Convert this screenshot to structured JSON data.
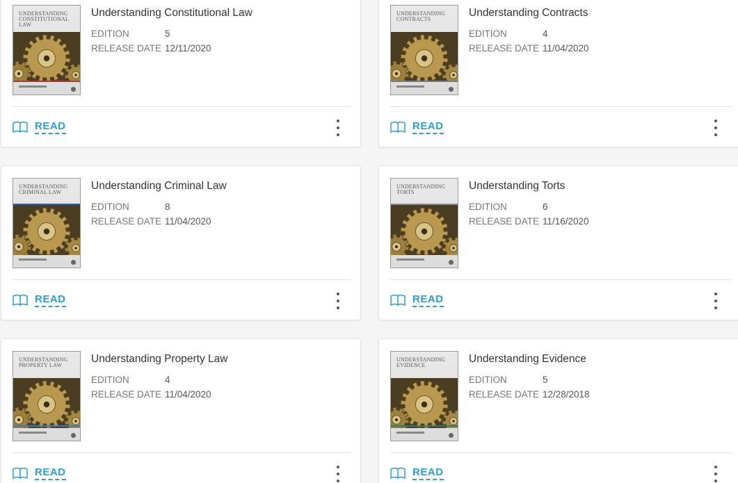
{
  "labels": {
    "edition": "EDITION",
    "release_date": "RELEASE DATE",
    "read": "READ"
  },
  "colors": {
    "accent": "#2a9fd6"
  },
  "books": [
    {
      "title": "Understanding Constitutional Law",
      "cover_text": "Understanding Constitutional Law",
      "band_color": "#b03a2e",
      "edition": "5",
      "release_date": "12/11/2020"
    },
    {
      "title": "Understanding Contracts",
      "cover_text": "Understanding Contracts",
      "band_color": "#7a7a7a",
      "edition": "4",
      "release_date": "11/04/2020"
    },
    {
      "title": "Understanding Criminal Law",
      "cover_text": "Understanding Criminal Law",
      "band_color": "#2e5fa8",
      "edition": "8",
      "release_date": "11/04/2020"
    },
    {
      "title": "Understanding Torts",
      "cover_text": "Understanding Torts",
      "band_color": "#8a8a8a",
      "edition": "6",
      "release_date": "11/16/2020"
    },
    {
      "title": "Understanding Property Law",
      "cover_text": "Understanding Property Law",
      "band_color": "#3a78c2",
      "edition": "4",
      "release_date": "11/04/2020"
    },
    {
      "title": "Understanding Evidence",
      "cover_text": "Understanding Evidence",
      "band_color": "#2f7a6a",
      "edition": "5",
      "release_date": "12/28/2018"
    }
  ]
}
